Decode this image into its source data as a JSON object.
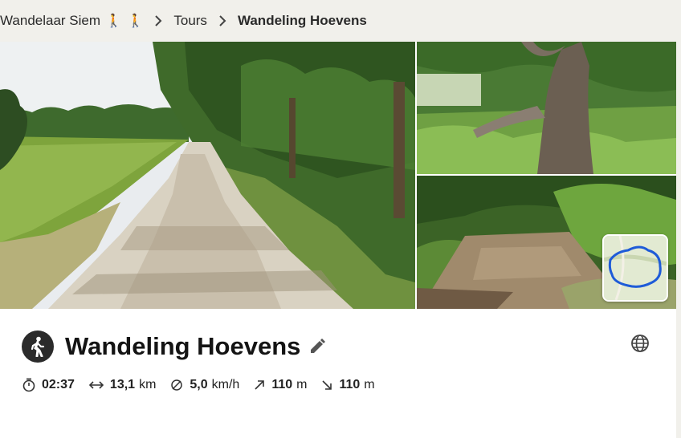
{
  "breadcrumb": {
    "owner": "Wandelaar Siem",
    "section": "Tours",
    "current": "Wandeling Hoevens"
  },
  "tour": {
    "title": "Wandeling Hoevens",
    "type_icon": "hiking-icon"
  },
  "stats": {
    "duration": {
      "icon": "stopwatch-icon",
      "value": "02:37"
    },
    "distance": {
      "icon": "distance-arrows-icon",
      "value": "13,1",
      "unit": "km"
    },
    "speed": {
      "icon": "speed-icon",
      "value": "5,0",
      "unit": "km/h"
    },
    "uphill": {
      "icon": "uphill-arrow-icon",
      "value": "110",
      "unit": "m"
    },
    "downhill": {
      "icon": "downhill-arrow-icon",
      "value": "110",
      "unit": "m"
    }
  },
  "colors": {
    "route": "#1e5bd8",
    "badge": "#2b2b2b",
    "walker_emoji": "#e8a33a"
  }
}
